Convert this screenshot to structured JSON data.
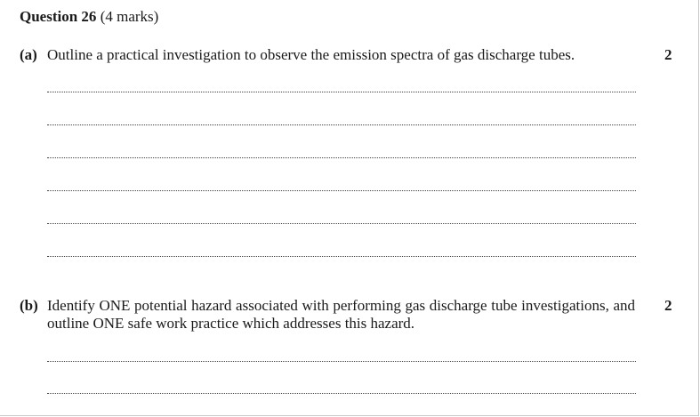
{
  "question": {
    "number_label": "Question 26",
    "marks_label": "(4 marks)"
  },
  "parts": [
    {
      "label": "(a)",
      "text": "Outline a practical investigation to observe the emission spectra of gas discharge tubes.",
      "marks": "2",
      "answer_lines": 6
    },
    {
      "label": "(b)",
      "text": "Identify ONE potential hazard associated with performing gas discharge tube investigations, and outline ONE safe work practice which addresses this hazard.",
      "marks": "2",
      "answer_lines": 2
    }
  ]
}
